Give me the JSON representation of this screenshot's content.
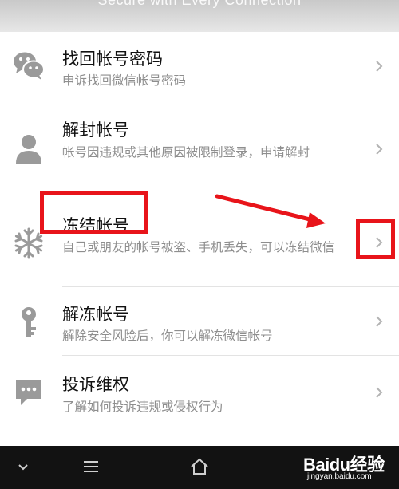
{
  "header": {
    "subtitle": "Secure with Every Connection"
  },
  "menu": {
    "items": [
      {
        "title": "找回帐号密码",
        "desc": "申诉找回微信帐号密码",
        "icon": "wechat-icon"
      },
      {
        "title": "解封帐号",
        "desc": "帐号因违规或其他原因被限制登录，申请解封",
        "icon": "user-icon"
      },
      {
        "title": "冻结帐号",
        "desc": "自己或朋友的帐号被盗、手机丢失，可以冻结微信",
        "icon": "snowflake-icon"
      },
      {
        "title": "解冻帐号",
        "desc": "解除安全风险后，你可以解冻微信帐号",
        "icon": "key-icon"
      },
      {
        "title": "投诉维权",
        "desc": "了解如何投诉违规或侵权行为",
        "icon": "chat-bubble-icon"
      }
    ]
  },
  "bottom_nav": {
    "buttons": [
      "chevron-down-icon",
      "menu-icon",
      "home-icon"
    ]
  },
  "watermark": {
    "text": "Baidu经验",
    "url": "jingyan.baidu.com"
  },
  "colors": {
    "annotation": "#e8141a",
    "icon": "#9a9a9a",
    "bottom_bar": "#121212"
  }
}
